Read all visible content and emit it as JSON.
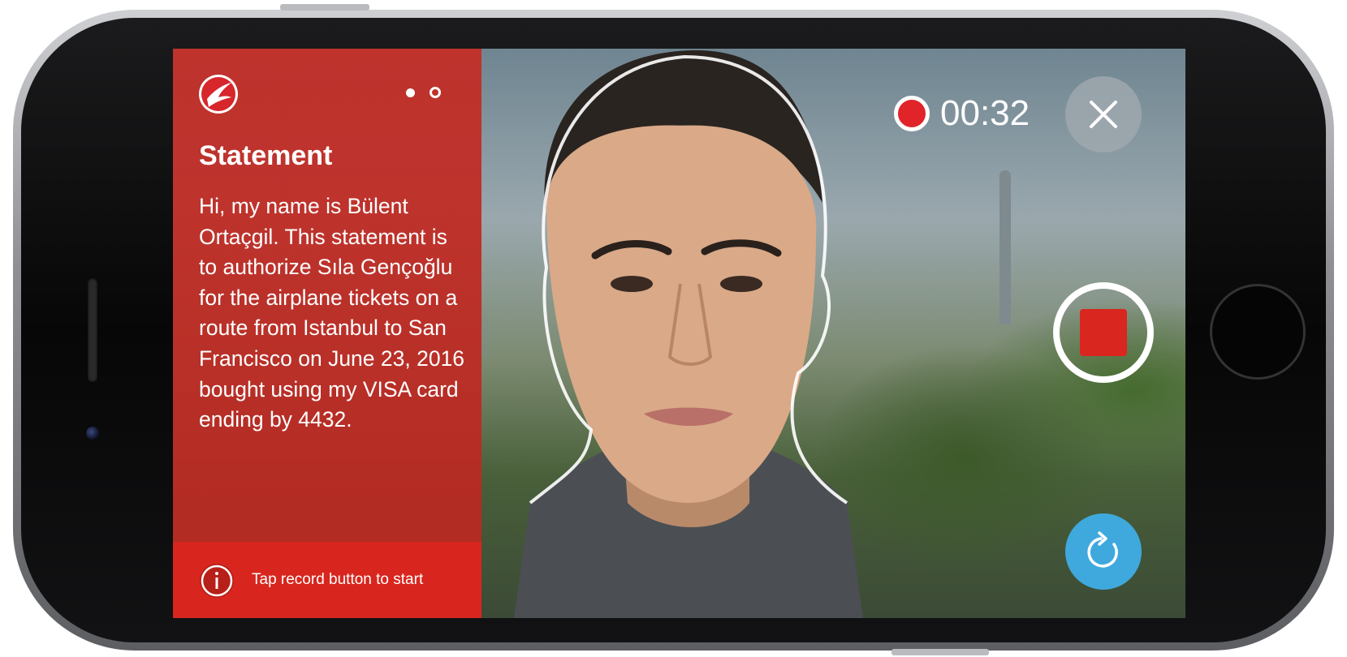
{
  "panel": {
    "title": "Statement",
    "statement_text": "Hi, my name is Bülent Ortaçgil. This statement is to authorize Sıla Gençoğlu for the airplane tickets on a route from Istanbul to San Francisco on June 23, 2016 bought using my VISA card ending by 4432.",
    "pagination": {
      "total": 2,
      "current": 2
    },
    "info_text": "Tap record button to start"
  },
  "recording": {
    "timer": "00:32"
  },
  "icons": {
    "logo": "turkish-airlines-logo",
    "close": "close-icon",
    "stop": "stop-icon",
    "retry": "refresh-icon",
    "info": "info-icon",
    "record_indicator": "record-dot-icon"
  },
  "colors": {
    "panel_red": "#c42e26",
    "info_bar_red": "#d8261e",
    "record_red": "#e0242a",
    "stop_red": "#d9261e",
    "retry_blue": "#3fa9dd"
  }
}
